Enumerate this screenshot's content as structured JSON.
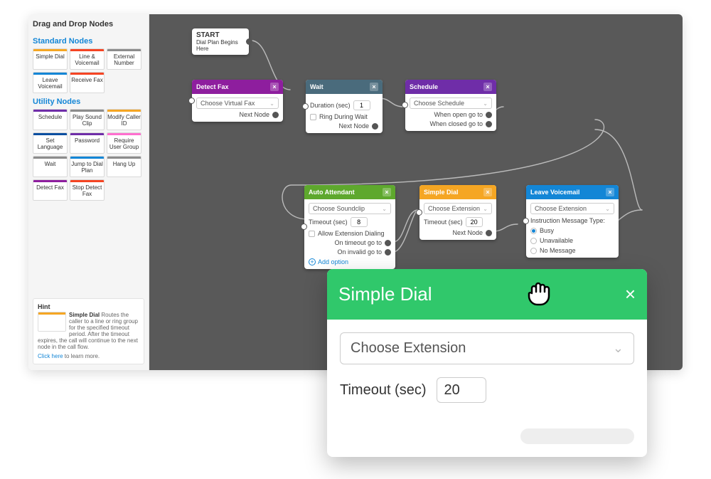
{
  "sidebar": {
    "title": "Drag and Drop Nodes",
    "sections": [
      {
        "label": "Standard Nodes",
        "nodes": [
          {
            "label": "Simple Dial",
            "color": "#f5a623"
          },
          {
            "label": "Line & Voicemail",
            "color": "#f54423"
          },
          {
            "label": "External Number",
            "color": "#8c8c8c"
          },
          {
            "label": "Leave Voicemail",
            "color": "#1386d6"
          },
          {
            "label": "Receive Fax",
            "color": "#f54423"
          }
        ]
      },
      {
        "label": "Utility Nodes",
        "nodes": [
          {
            "label": "Schedule",
            "color": "#6f2da8"
          },
          {
            "label": "Play Sound Clip",
            "color": "#8c8c8c"
          },
          {
            "label": "Modify Caller ID",
            "color": "#f5a623"
          },
          {
            "label": "Set Language",
            "color": "#0b4fa0"
          },
          {
            "label": "Password",
            "color": "#6f2da8"
          },
          {
            "label": "Require User Group",
            "color": "#ff6fcf"
          },
          {
            "label": "Wait",
            "color": "#8c8c8c"
          },
          {
            "label": "Jump to Dial Plan",
            "color": "#1386d6"
          },
          {
            "label": "Hang Up",
            "color": "#8c8c8c"
          },
          {
            "label": "Detect Fax",
            "color": "#8e1e9e"
          },
          {
            "label": "Stop Detect Fax",
            "color": "#f54423"
          }
        ]
      }
    ],
    "hint": {
      "heading": "Hint",
      "title": "Simple Dial",
      "text": "Routes the caller to a line or ring group for the specified timeout period. After the timeout expires, the call will continue to the next node in the call flow.",
      "link_pre": "Click here",
      "link_post": " to learn more."
    }
  },
  "canvas": {
    "start": {
      "title": "START",
      "sub": "Dial Plan Begins Here"
    },
    "detect_fax": {
      "title": "Detect Fax",
      "select": "Choose Virtual Fax",
      "out": "Next Node"
    },
    "wait": {
      "title": "Wait",
      "dur_label": "Duration (sec)",
      "dur_val": "1",
      "ring": "Ring During Wait",
      "out": "Next Node"
    },
    "schedule": {
      "title": "Schedule",
      "select": "Choose Schedule",
      "open": "When open go to",
      "closed": "When closed go to"
    },
    "auto": {
      "title": "Auto Attendant",
      "select": "Choose Soundclip",
      "to_label": "Timeout (sec)",
      "to_val": "8",
      "allow": "Allow Extension Dialing",
      "on_to": "On timeout go to",
      "on_inv": "On invalid go to",
      "add": "Add option"
    },
    "simple": {
      "title": "Simple Dial",
      "select": "Choose Extension",
      "to_label": "Timeout (sec)",
      "to_val": "20",
      "out": "Next Node"
    },
    "voicemail": {
      "title": "Leave Voicemail",
      "select": "Choose Extension",
      "instr": "Instruction Message Type:",
      "opts": [
        "Busy",
        "Unavailable",
        "No Message"
      ]
    }
  },
  "overlay": {
    "title": "Simple Dial",
    "select": "Choose Extension",
    "to_label": "Timeout (sec)",
    "to_val": "20"
  },
  "colors": {
    "detect": "#8e1e9e",
    "wait": "#4a6b7c",
    "schedule": "#6f2da8",
    "auto": "#5ea82d",
    "simple": "#f5a623",
    "voicemail": "#1386d6"
  }
}
